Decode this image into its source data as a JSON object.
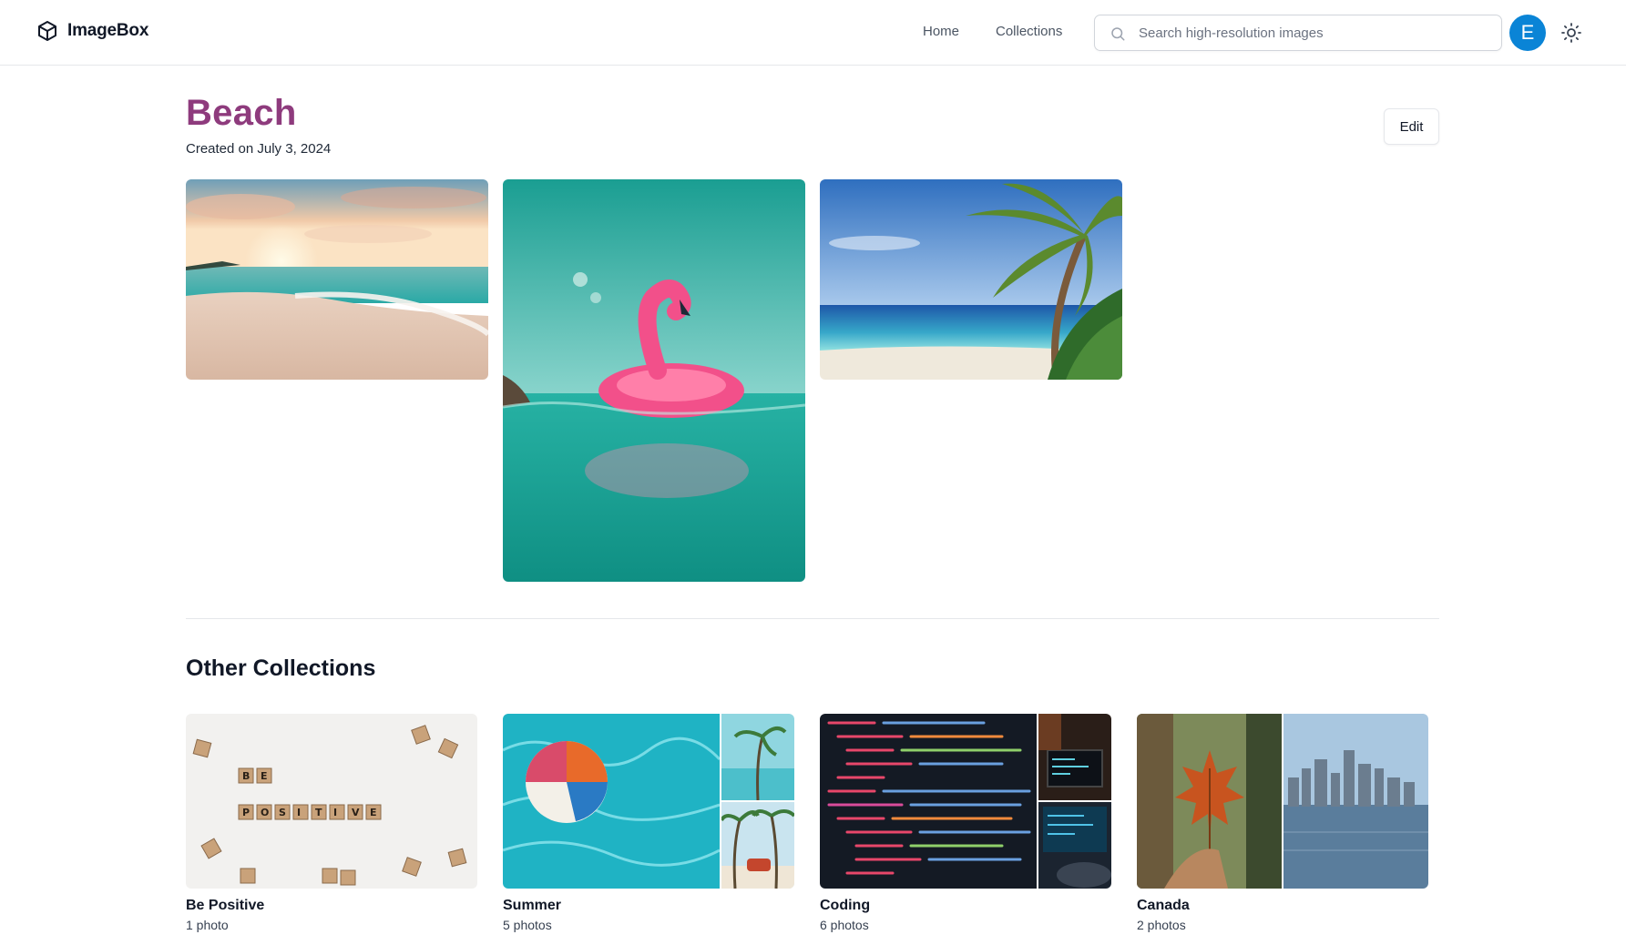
{
  "app": {
    "name": "ImageBox"
  },
  "nav": {
    "home": "Home",
    "collections": "Collections"
  },
  "search": {
    "placeholder": "Search high-resolution images",
    "value": ""
  },
  "user": {
    "avatar_initial": "E",
    "avatar_color": "#0a84d6"
  },
  "collection": {
    "title": "Beach",
    "created": "Created on July 3, 2024",
    "edit_label": "Edit",
    "title_color": "#8e3b7d",
    "photos": [
      {
        "subject": "sunset beach with waves"
      },
      {
        "subject": "pink flamingo float in turquoise water"
      },
      {
        "subject": "palm tree over tropical beach"
      }
    ]
  },
  "other": {
    "heading": "Other Collections",
    "items": [
      {
        "name": "Be Positive",
        "count": "1 photo"
      },
      {
        "name": "Summer",
        "count": "5 photos"
      },
      {
        "name": "Coding",
        "count": "6 photos"
      },
      {
        "name": "Canada",
        "count": "2 photos"
      }
    ]
  },
  "icons": {
    "logo": "cube-icon",
    "search": "search-icon",
    "theme": "sun-icon"
  }
}
